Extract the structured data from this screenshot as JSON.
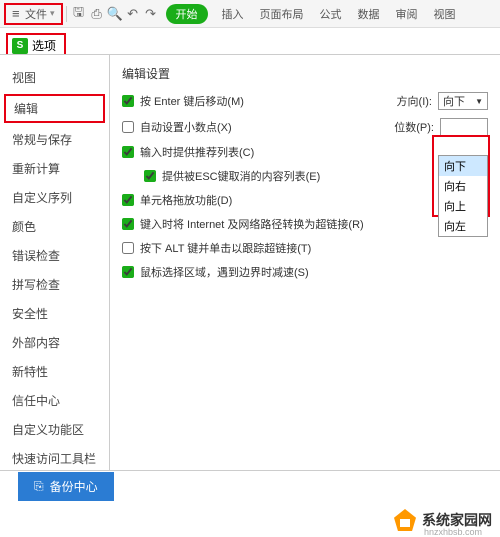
{
  "toolbar": {
    "file_label": "文件",
    "start_label": "开始",
    "menus": [
      "插入",
      "页面布局",
      "公式",
      "数据",
      "审阅",
      "视图"
    ]
  },
  "tab": {
    "label": "选项"
  },
  "sidebar": {
    "items": [
      {
        "label": "视图"
      },
      {
        "label": "编辑",
        "active": true
      },
      {
        "label": "常规与保存"
      },
      {
        "label": "重新计算"
      },
      {
        "label": "自定义序列"
      },
      {
        "label": "颜色"
      },
      {
        "label": "错误检查"
      },
      {
        "label": "拼写检查"
      },
      {
        "label": "安全性"
      },
      {
        "label": "外部内容"
      },
      {
        "label": "新特性"
      },
      {
        "label": "信任中心"
      },
      {
        "label": "自定义功能区"
      },
      {
        "label": "快速访问工具栏"
      }
    ]
  },
  "content": {
    "section_title": "编辑设置",
    "opts": {
      "enter_move": "按 Enter 键后移动(M)",
      "auto_decimal": "自动设置小数点(X)",
      "input_suggest": "输入时提供推荐列表(C)",
      "esc_cancel": "提供被ESC键取消的内容列表(E)",
      "cell_drag": "单元格拖放功能(D)",
      "internet_link": "键入时将 Internet 及网络路径转换为超链接(R)",
      "alt_click": "按下 ALT 键并单击以跟踪超链接(T)",
      "mouse_select": "鼠标选择区域，遇到边界时减速(S)"
    },
    "direction_label": "方向(I):",
    "places_label": "位数(P):",
    "direction_value": "向下",
    "places_value": "",
    "dropdown_options": [
      "向下",
      "向右",
      "向上",
      "向左"
    ]
  },
  "footer": {
    "backup_label": "备份中心"
  },
  "watermark": {
    "text": "系统家园网",
    "sub": "hnzxhbsb.com"
  }
}
